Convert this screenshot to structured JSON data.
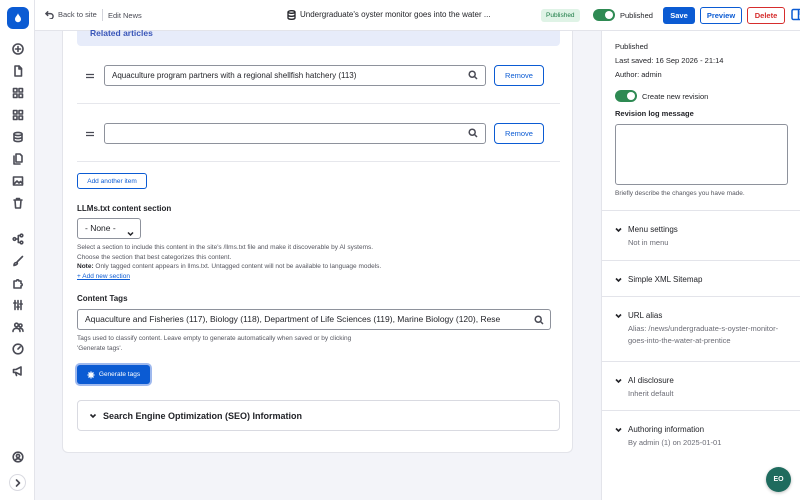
{
  "topbar": {
    "back_label": "Back to site",
    "breadcrumb": "Edit News",
    "node_title": "Undergraduate's oyster monitor goes into the water ...",
    "status_badge": "Published",
    "published_label": "Published",
    "save_label": "Save",
    "preview_label": "Preview",
    "delete_label": "Delete"
  },
  "related": {
    "heading": "Related articles",
    "items": [
      {
        "value": "Aquaculture program partners with a regional shellfish hatchery (113)",
        "remove_label": "Remove"
      },
      {
        "value": "",
        "remove_label": "Remove"
      }
    ],
    "add_label": "Add another item"
  },
  "llms": {
    "label": "LLMs.txt content section",
    "selected": "- None -",
    "desc_line1": "Select a section to include this content in the site's /llms.txt file and make it discoverable by AI systems.",
    "desc_line2": "Choose the section that best categorizes this content.",
    "note_label": "Note:",
    "note_text": " Only tagged content appears in llms.txt. Untagged content will not be available to language models.",
    "add_section": "+ Add new section"
  },
  "tags": {
    "label": "Content Tags",
    "value": "Aquaculture and Fisheries (117), Biology (118), Department of Life Sciences (119), Marine Biology (120), Rese",
    "desc_line1": "Tags used to classify content. Leave empty to generate automatically when saved or by clicking",
    "desc_line2": "'Generate tags'.",
    "generate_label": "Generate tags"
  },
  "seo": {
    "label": "Search Engine Optimization (SEO) Information"
  },
  "sidebar": {
    "status": "Published",
    "last_saved": "Last saved: 16 Sep 2026 - 21:14",
    "author": "Author: admin",
    "create_revision": "Create new revision",
    "revision_label": "Revision log message",
    "revision_help": "Briefly describe the changes you have made.",
    "sections": [
      {
        "title": "Menu settings",
        "sub": "Not in menu"
      },
      {
        "title": "Simple XML Sitemap",
        "sub": ""
      },
      {
        "title": "URL alias",
        "sub": "Alias: /news/undergraduate-s-oyster-monitor-goes-into-the-water-at-prentice"
      },
      {
        "title": "AI disclosure",
        "sub": "Inherit default"
      },
      {
        "title": "Authoring information",
        "sub": "By admin (1) on 2025-01-01"
      }
    ]
  },
  "fab_label": "EO",
  "colors": {
    "primary": "#0b5bd3",
    "danger": "#d62d2d",
    "toggle_on": "#2e8a53",
    "badge_bg": "#dff3e6",
    "fab": "#1e6b5e"
  },
  "icons": [
    "drupal-logo-icon",
    "plus-circle-icon",
    "file-icon",
    "grid-icon",
    "blocks-icon",
    "database-icon",
    "files-icon",
    "image-icon",
    "trash-icon",
    "structure-icon",
    "brush-icon",
    "puzzle-icon",
    "sliders-icon",
    "users-icon",
    "gauge-icon",
    "megaphone-icon",
    "user-circle-icon",
    "chevron-right-icon"
  ]
}
